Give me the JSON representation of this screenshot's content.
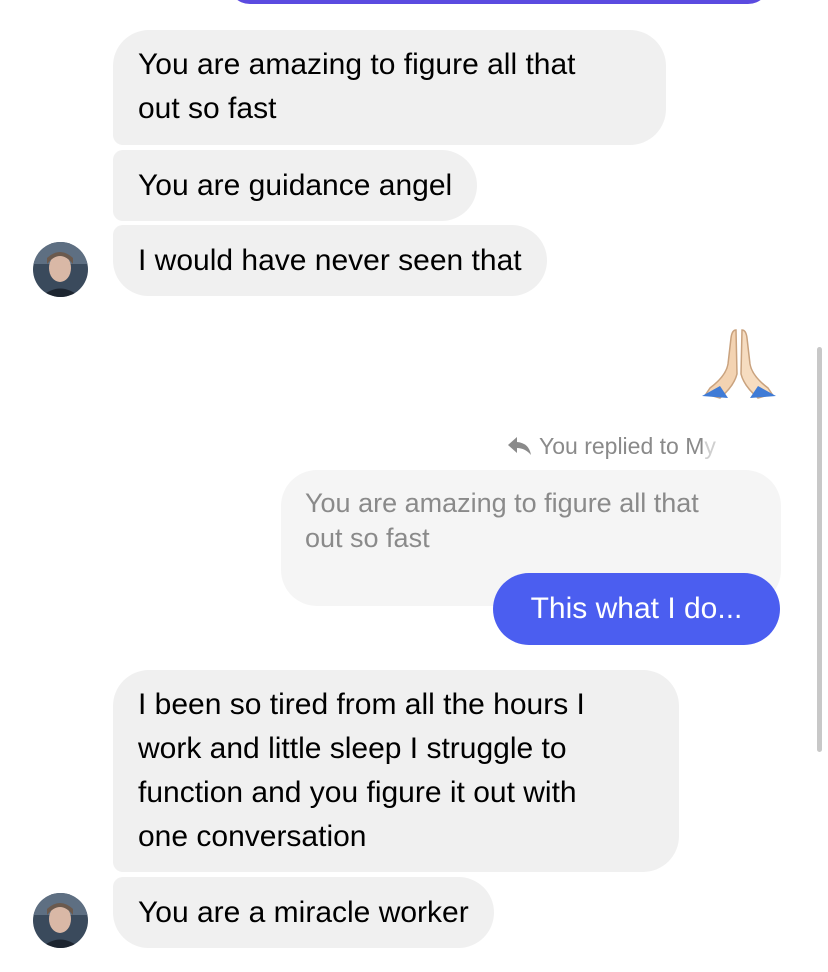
{
  "colors": {
    "incoming_bubble": "#f0f0f0",
    "outgoing_bubble": "#4b5ef0",
    "top_bubble": "#5b4be0",
    "meta_text": "#8a8a8a"
  },
  "messages": {
    "m1": {
      "line1": "You are amazing to figure all that",
      "line2": "out so fast"
    },
    "m2": "You are guidance angel",
    "m3": "I would have never seen that",
    "reaction_icon": "folded-hands-emoji",
    "reply_header": {
      "text": "You replied to M",
      "faded": "y",
      "icon": "reply-arrow-icon"
    },
    "quoted": {
      "line1": "You are amazing to figure all that",
      "line2": "out so fast"
    },
    "sent": "This what I do...",
    "m4": {
      "line1": "I been so tired from all the hours I",
      "line2": "work and little sleep I struggle to",
      "line3": "function and you figure it out with",
      "line4": "one conversation"
    },
    "m5": "You are a miracle worker"
  }
}
